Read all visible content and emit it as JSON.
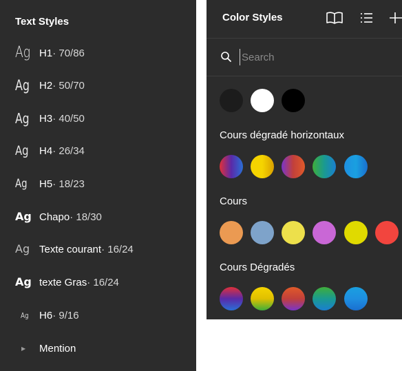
{
  "text_styles": {
    "title": "Text Styles",
    "items": [
      {
        "ag": "Ag",
        "name": "H1",
        "meta": " · 70/86"
      },
      {
        "ag": "Ag",
        "name": "H2",
        "meta": " · 50/70"
      },
      {
        "ag": "Ag",
        "name": "H3",
        "meta": " · 40/50"
      },
      {
        "ag": "Ag",
        "name": "H4",
        "meta": " · 26/34"
      },
      {
        "ag": "Ag",
        "name": "H5",
        "meta": " · 18/23"
      },
      {
        "ag": "Ag",
        "name": "Chapo",
        "meta": " · 18/30"
      },
      {
        "ag": "Ag",
        "name": "Texte courant",
        "meta": " · 16/24"
      },
      {
        "ag": "Ag",
        "name": "texte Gras",
        "meta": " · 16/24"
      },
      {
        "ag": "Ag",
        "name": "H6",
        "meta": " · 9/16"
      }
    ],
    "group": {
      "caret": "▶",
      "name": "Mention"
    }
  },
  "color_styles": {
    "title": "Color Styles",
    "icons": [
      "library-icon",
      "list-view-icon",
      "add-icon"
    ],
    "search": {
      "placeholder": "Search",
      "value": ""
    },
    "ungrouped": [
      {
        "color": "#1c1c1c"
      },
      {
        "color": "#ffffff"
      },
      {
        "color": "#000000"
      }
    ],
    "sections": [
      {
        "label": "Cours dégradé horizontaux",
        "swatches": [
          {
            "gradient": "linear-gradient(90deg,#e0303a,#5a2aa8,#2a6fd6)"
          },
          {
            "gradient": "linear-gradient(90deg,#f5d400,#f5d400,#d9a000)"
          },
          {
            "gradient": "linear-gradient(90deg,#7a35c9,#c2403a,#e05a2a)"
          },
          {
            "gradient": "linear-gradient(90deg,#3fae3a,#1a9a90,#1a7fd0)"
          },
          {
            "gradient": "linear-gradient(90deg,#1e8fe0,#1aa0e0,#1a6fd0)"
          }
        ]
      },
      {
        "label": "Cours",
        "swatches": [
          {
            "color": "#eb9a52"
          },
          {
            "color": "#7ea3ca"
          },
          {
            "color": "#ede04b"
          },
          {
            "color": "#c967d6"
          },
          {
            "color": "#e0da00"
          },
          {
            "color": "#f2453e"
          }
        ]
      },
      {
        "label": "Cours Dégradés",
        "swatches": [
          {
            "gradient": "linear-gradient(180deg,#e0303a,#5a2aa8,#2a6fd6)"
          },
          {
            "gradient": "linear-gradient(180deg,#f5d400,#e0c000,#3fae3a)"
          },
          {
            "gradient": "linear-gradient(180deg,#e05a2a,#c2403a,#7a35c9)"
          },
          {
            "gradient": "linear-gradient(180deg,#3fae3a,#1a9a90,#1a7fd0)"
          },
          {
            "gradient": "linear-gradient(180deg,#1aa0e0,#1e8fe0,#1a6fd0)"
          }
        ]
      }
    ]
  }
}
